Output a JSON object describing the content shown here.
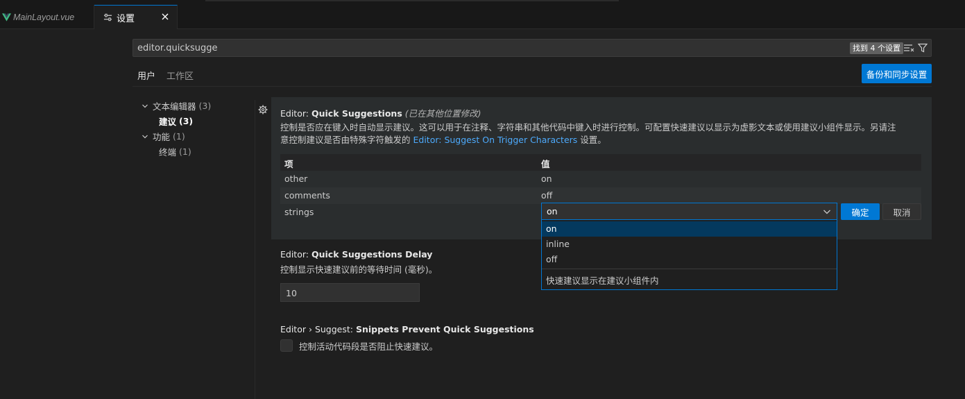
{
  "tabs": [
    {
      "label": "MainLayout.vue",
      "icon": "vue-icon"
    },
    {
      "label": "设置",
      "icon": "settings-sliders-icon",
      "active": true
    }
  ],
  "search": {
    "value": "editor.quicksugge",
    "result_count": "找到 4 个设置"
  },
  "scope_tabs": {
    "user": "用户",
    "workspace": "工作区"
  },
  "sync_button": "备份和同步设置",
  "toc": [
    {
      "label": "文本编辑器",
      "count": "(3)"
    },
    {
      "label": "建议",
      "count": "(3)"
    },
    {
      "label": "功能",
      "count": "(1)"
    },
    {
      "label": "终端",
      "count": "(1)"
    }
  ],
  "setting1": {
    "category": "Editor: ",
    "name": "Quick Suggestions",
    "modified_note": "(已在其他位置修改)",
    "desc_line1": "控制是否应在键入时自动显示建议。这可以用于在注释、字符串和其他代码中键入时进行控制。可配置快速建议以显示为虚影文本或使用建议小组件显示。另请注",
    "desc_line2_pre": "意控制建议是否由特殊字符触发的 ",
    "desc_link": "Editor: Suggest On Trigger Characters",
    "desc_line2_post": " 设置。",
    "table": {
      "header_key": "项",
      "header_value": "值",
      "rows": [
        {
          "key": "other",
          "value": "on"
        },
        {
          "key": "comments",
          "value": "off"
        },
        {
          "key": "strings",
          "value": "on"
        }
      ]
    },
    "select_value": "on",
    "ok": "确定",
    "cancel": "取消",
    "dropdown_options": [
      "on",
      "inline",
      "off"
    ],
    "dropdown_description": "快速建议显示在建议小组件内"
  },
  "setting2": {
    "category": "Editor: ",
    "name": "Quick Suggestions Delay",
    "desc": "控制显示快速建议前的等待时间 (毫秒)。",
    "value": "10"
  },
  "setting3": {
    "category": "Editor › Suggest: ",
    "name": "Snippets Prevent Quick Suggestions",
    "desc": "控制活动代码段是否阻止快速建议。",
    "checked": false
  },
  "colors": {
    "accent": "#0078d4",
    "link": "#4daafc",
    "background": "#1f1f1f"
  }
}
